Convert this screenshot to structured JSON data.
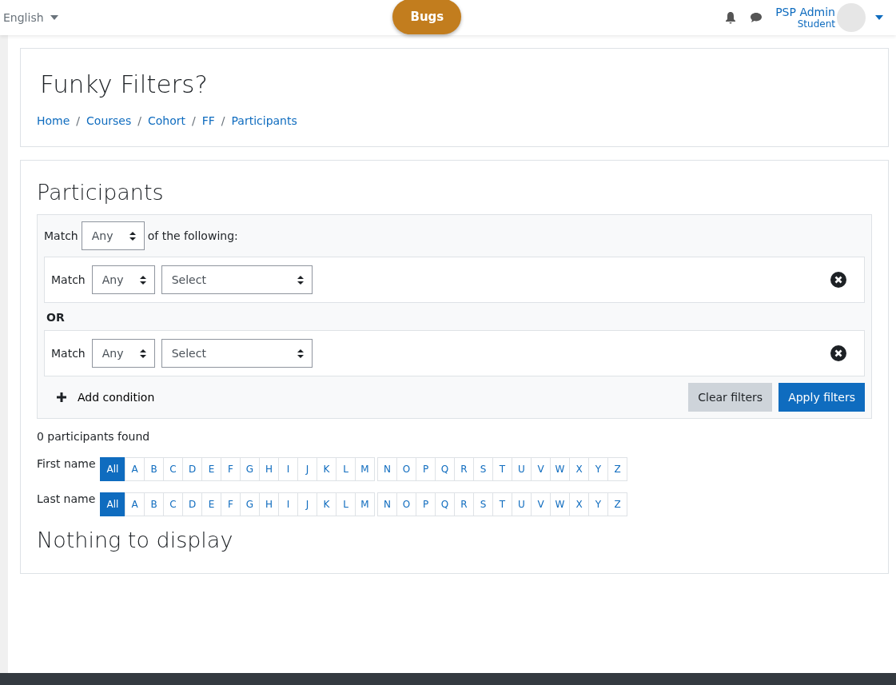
{
  "navbar": {
    "language": "English",
    "badge": "Bugs",
    "user_name": "PSP Admin",
    "user_role": "Student"
  },
  "header": {
    "title": "Funky Filters?",
    "breadcrumbs": [
      "Home",
      "Courses",
      "Cohort",
      "FF",
      "Participants"
    ],
    "separator": "/"
  },
  "participants": {
    "heading": "Participants",
    "filter": {
      "match_label": "Match",
      "match_value": "Any",
      "suffix": "of the following:",
      "joiner": "OR",
      "rows": [
        {
          "match_label": "Match",
          "match_value": "Any",
          "field_value": "Select"
        },
        {
          "match_label": "Match",
          "match_value": "Any",
          "field_value": "Select"
        }
      ],
      "add_label": "Add condition",
      "buttons": [
        {
          "label": "Clear filters",
          "kind": "secondary"
        },
        {
          "label": "Apply filters",
          "kind": "primary"
        }
      ]
    },
    "found": "0 participants found",
    "initials": [
      {
        "label": "First name",
        "groups": [
          [
            {
              "text": "All",
              "selected": true
            },
            {
              "text": "A",
              "selected": false
            },
            {
              "text": "B",
              "selected": false
            },
            {
              "text": "C",
              "selected": false
            },
            {
              "text": "D",
              "selected": false
            },
            {
              "text": "E",
              "selected": false
            },
            {
              "text": "F",
              "selected": false
            },
            {
              "text": "G",
              "selected": false
            },
            {
              "text": "H",
              "selected": false
            },
            {
              "text": "I",
              "selected": false
            },
            {
              "text": "J",
              "selected": false
            },
            {
              "text": "K",
              "selected": false
            },
            {
              "text": "L",
              "selected": false
            },
            {
              "text": "M",
              "selected": false
            }
          ],
          [
            {
              "text": "N",
              "selected": false
            },
            {
              "text": "O",
              "selected": false
            },
            {
              "text": "P",
              "selected": false
            },
            {
              "text": "Q",
              "selected": false
            },
            {
              "text": "R",
              "selected": false
            },
            {
              "text": "S",
              "selected": false
            },
            {
              "text": "T",
              "selected": false
            },
            {
              "text": "U",
              "selected": false
            },
            {
              "text": "V",
              "selected": false
            },
            {
              "text": "W",
              "selected": false
            },
            {
              "text": "X",
              "selected": false
            },
            {
              "text": "Y",
              "selected": false
            },
            {
              "text": "Z",
              "selected": false
            }
          ]
        ]
      },
      {
        "label": "Last name",
        "groups": [
          [
            {
              "text": "All",
              "selected": true
            },
            {
              "text": "A",
              "selected": false
            },
            {
              "text": "B",
              "selected": false
            },
            {
              "text": "C",
              "selected": false
            },
            {
              "text": "D",
              "selected": false
            },
            {
              "text": "E",
              "selected": false
            },
            {
              "text": "F",
              "selected": false
            },
            {
              "text": "G",
              "selected": false
            },
            {
              "text": "H",
              "selected": false
            },
            {
              "text": "I",
              "selected": false
            },
            {
              "text": "J",
              "selected": false
            },
            {
              "text": "K",
              "selected": false
            },
            {
              "text": "L",
              "selected": false
            },
            {
              "text": "M",
              "selected": false
            }
          ],
          [
            {
              "text": "N",
              "selected": false
            },
            {
              "text": "O",
              "selected": false
            },
            {
              "text": "P",
              "selected": false
            },
            {
              "text": "Q",
              "selected": false
            },
            {
              "text": "R",
              "selected": false
            },
            {
              "text": "S",
              "selected": false
            },
            {
              "text": "T",
              "selected": false
            },
            {
              "text": "U",
              "selected": false
            },
            {
              "text": "V",
              "selected": false
            },
            {
              "text": "W",
              "selected": false
            },
            {
              "text": "X",
              "selected": false
            },
            {
              "text": "Y",
              "selected": false
            },
            {
              "text": "Z",
              "selected": false
            }
          ]
        ]
      }
    ],
    "empty": "Nothing to display"
  }
}
